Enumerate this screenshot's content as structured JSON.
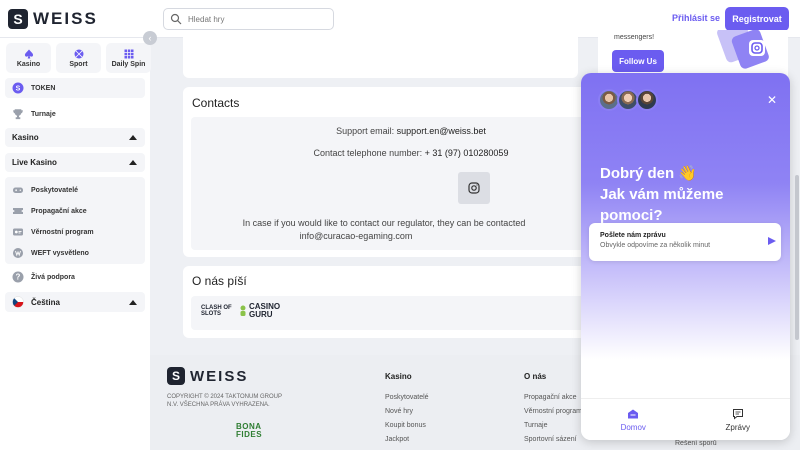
{
  "header": {
    "logo_text": "WEISS",
    "logo_mark": "S",
    "search_placeholder": "Hledat hry",
    "login_label": "Přihlásit se",
    "register_label": "Registrovat"
  },
  "sidebar": {
    "collapse_glyph": "‹",
    "tiles": [
      {
        "label": "Kasino",
        "icon": "spade-icon"
      },
      {
        "label": "Sport",
        "icon": "ball-icon"
      },
      {
        "label": "Daily Spin",
        "icon": "grid-icon"
      }
    ],
    "token_label": "TOKEN",
    "tournaments_label": "Turnaje",
    "casino_label": "Kasino",
    "live_casino_label": "Live Kasino",
    "items": [
      {
        "label": "Poskytovatelé",
        "icon": "gamepad-icon"
      },
      {
        "label": "Propagační akce",
        "icon": "ticket-icon"
      },
      {
        "label": "Věrnostní program",
        "icon": "loyalty-icon"
      },
      {
        "label": "WEFT vysvětleno",
        "icon": "weft-icon"
      }
    ],
    "support_label": "Živá podpora",
    "language_label": "Čeština"
  },
  "promo": {
    "text": "messengers!",
    "follow_label": "Follow Us"
  },
  "contacts": {
    "title": "Contacts",
    "email_label": "Support email:",
    "email_value": "support.en@weiss.bet",
    "phone_label": "Contact telephone number:",
    "phone_value": "+ 31 (97) 010280059",
    "regulator_text": "In case if you would like to contact our regulator, they can be contacted",
    "regulator_email": "info@curacao-egaming.com"
  },
  "about": {
    "title": "O nás píší",
    "logos": [
      "CLASH OF SLOTS",
      "CASINO GURU"
    ]
  },
  "footer": {
    "logo_text": "WEISS",
    "copyright_line1": "COPYRIGHT © 2024 TAKTONUM GROUP",
    "copyright_line2": "N.V. VŠECHNA PRÁVA VYHRAZENA.",
    "bona_text": "BONA FIDES",
    "col1": {
      "title": "Kasino",
      "items": [
        "Poskytovatelé",
        "Nové hry",
        "Koupit bonus",
        "Jackpot"
      ]
    },
    "col2": {
      "title": "O nás",
      "items": [
        "Propagační akce",
        "Věrnostní program",
        "Turnaje",
        "Sportovní sázení"
      ]
    },
    "col3_item": "Řešení sporů"
  },
  "chat": {
    "close_glyph": "✕",
    "greeting_line1": "Dobrý den 👋",
    "greeting_line2": "Jak vám můžeme",
    "greeting_line3": "pomoci?",
    "message_title": "Pošlete nám zprávu",
    "message_sub": "Obvykle odpovíme za několik minut",
    "nav_home": "Domov",
    "nav_messages": "Zprávy"
  },
  "colors": {
    "accent": "#6b5cf0",
    "dark": "#1f2430"
  }
}
